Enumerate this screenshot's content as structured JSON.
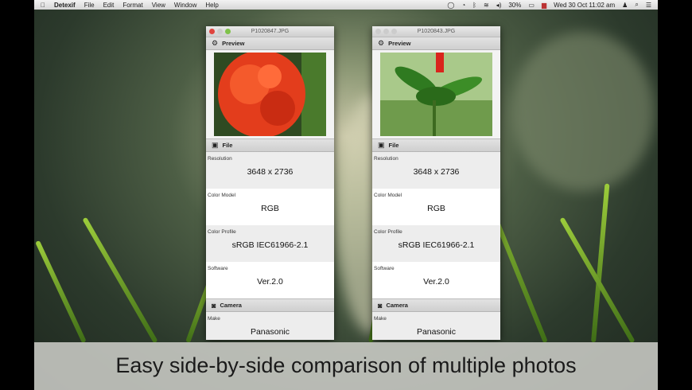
{
  "menubar": {
    "app": "Detexif",
    "items": [
      "File",
      "Edit",
      "Format",
      "View",
      "Window",
      "Help"
    ],
    "battery": "30%",
    "datetime": "Wed 30 Oct  11:02 am"
  },
  "windows": [
    {
      "title": "P1020847.JPG",
      "photo": "red-flower",
      "sections": {
        "preview": "Preview",
        "file": "File",
        "camera": "Camera"
      },
      "rows": [
        {
          "label": "Resolution",
          "value": "3648 x 2736"
        },
        {
          "label": "Color Model",
          "value": "RGB"
        },
        {
          "label": "Color Profile",
          "value": "sRGB IEC61966-2.1"
        },
        {
          "label": "Software",
          "value": "Ver.2.0"
        }
      ],
      "camera_rows": [
        {
          "label": "Make",
          "value": "Panasonic"
        }
      ]
    },
    {
      "title": "P1020843.JPG",
      "photo": "green-plant",
      "sections": {
        "preview": "Preview",
        "file": "File",
        "camera": "Camera"
      },
      "rows": [
        {
          "label": "Resolution",
          "value": "3648 x 2736"
        },
        {
          "label": "Color Model",
          "value": "RGB"
        },
        {
          "label": "Color Profile",
          "value": "sRGB IEC61966-2.1"
        },
        {
          "label": "Software",
          "value": "Ver.2.0"
        }
      ],
      "camera_rows": [
        {
          "label": "Make",
          "value": "Panasonic"
        }
      ]
    }
  ],
  "caption": "Easy side-by-side comparison of multiple photos"
}
